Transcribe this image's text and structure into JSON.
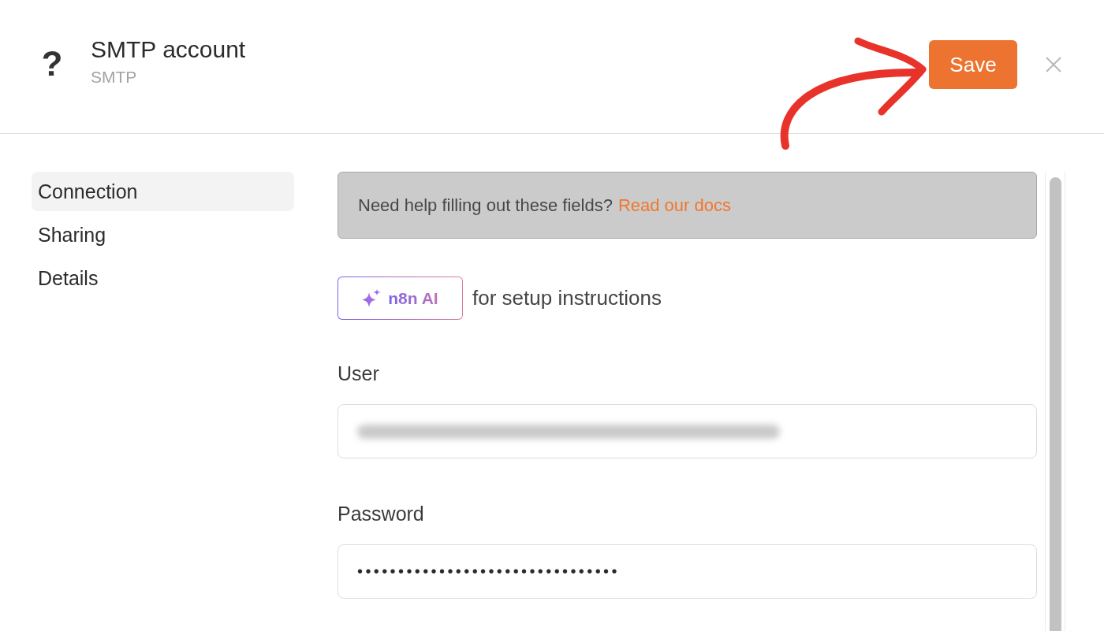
{
  "header": {
    "icon": "?",
    "title": "SMTP account",
    "subtitle": "SMTP",
    "save_button": "Save"
  },
  "sidebar": {
    "items": [
      {
        "label": "Connection",
        "selected": true
      },
      {
        "label": "Sharing",
        "selected": false
      },
      {
        "label": "Details",
        "selected": false
      }
    ]
  },
  "help_banner": {
    "text": "Need help filling out these fields?",
    "link": "Read our docs"
  },
  "ai_assist": {
    "button": "n8n AI",
    "text": "for setup instructions"
  },
  "fields": [
    {
      "label": "User",
      "kind": "blurred"
    },
    {
      "label": "Password",
      "kind": "masked",
      "value": "••••••••••••••••••••••••••••••••"
    }
  ]
}
